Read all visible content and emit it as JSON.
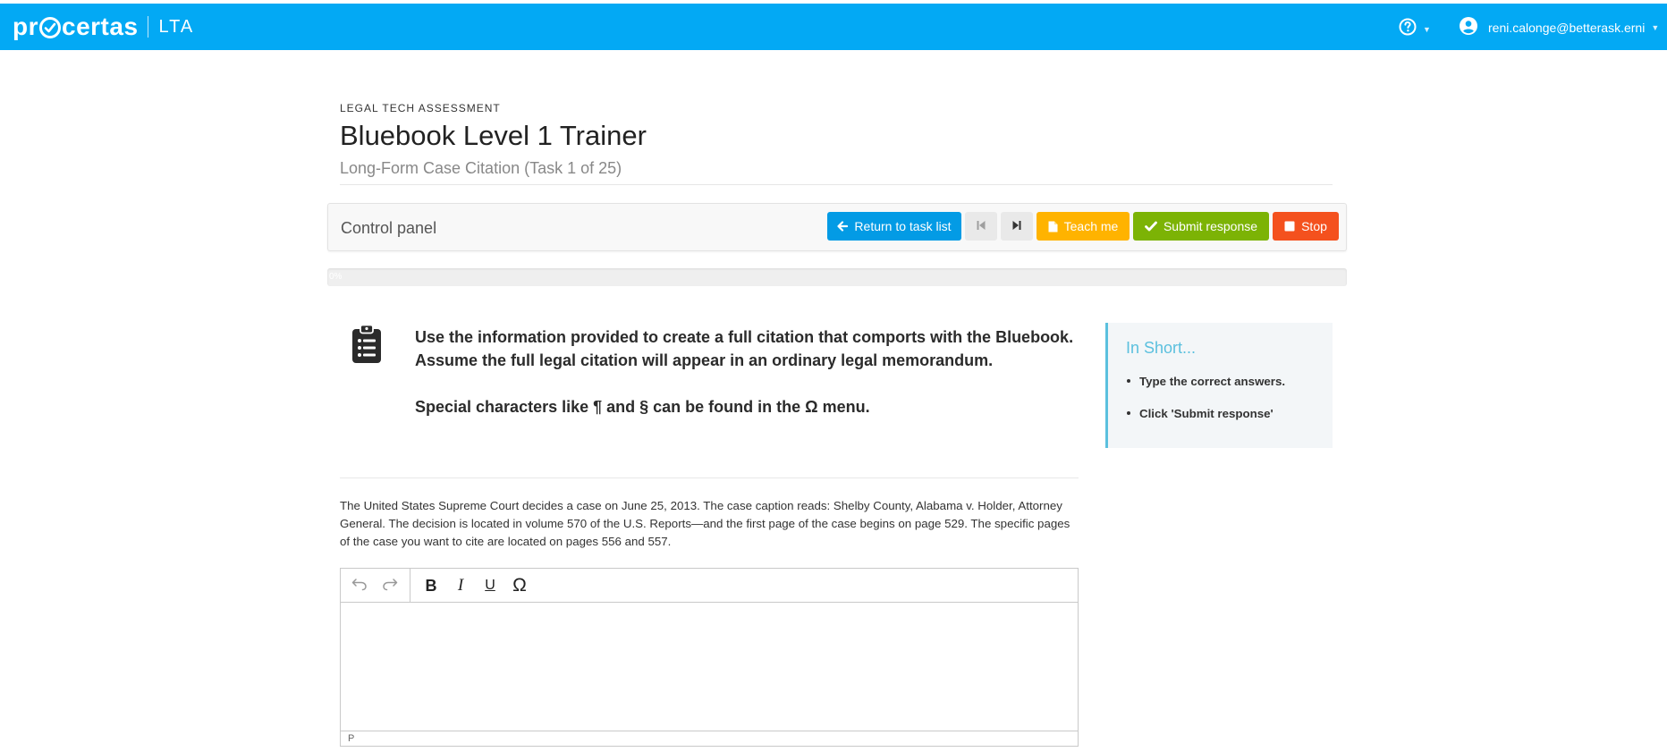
{
  "colors": {
    "topbar": "#03a9f4",
    "return_button": "#039be5",
    "teach_button": "#ffb300",
    "submit_button": "#7cb305",
    "stop_button": "#f4511e",
    "inshort_accent": "#5bc0de"
  },
  "topbar": {
    "logo_left": "pr",
    "logo_right": "certas",
    "product": "LTA",
    "help_icon": "question-circle-icon",
    "user_icon": "user-circle-icon",
    "user_email": "reni.calonge@betterask.erni"
  },
  "header": {
    "eyebrow": "LEGAL TECH ASSESSMENT",
    "title": "Bluebook Level 1 Trainer",
    "subtitle": "Long-Form Case Citation (Task 1 of 25)"
  },
  "control_panel": {
    "title": "Control panel",
    "return_label": "Return to task list",
    "teach_label": "Teach me",
    "submit_label": "Submit response",
    "stop_label": "Stop"
  },
  "progress": {
    "percent": 0,
    "label": "0%"
  },
  "instructions": {
    "line1": "Use the information provided to create a full citation that comports with the Bluebook. Assume the full legal citation will appear in an ordinary legal memorandum.",
    "line2": "Special characters like ¶ and § can be found in the Ω menu."
  },
  "prompt": "The United States Supreme Court decides a case on June 25, 2013. The case caption reads: Shelby County, Alabama v. Holder, Attorney General. The decision is located in volume 570 of the U.S. Reports—and the first page of the case begins on page 529. The specific pages of the case you want to cite are located on pages 556 and 557.",
  "editor": {
    "bold": "B",
    "italic": "I",
    "underline": "U",
    "special_chars": "Ω",
    "status_path": "P",
    "value": ""
  },
  "in_short": {
    "title": "In Short...",
    "items": [
      "Type the correct answers.",
      "Click 'Submit response'"
    ]
  }
}
